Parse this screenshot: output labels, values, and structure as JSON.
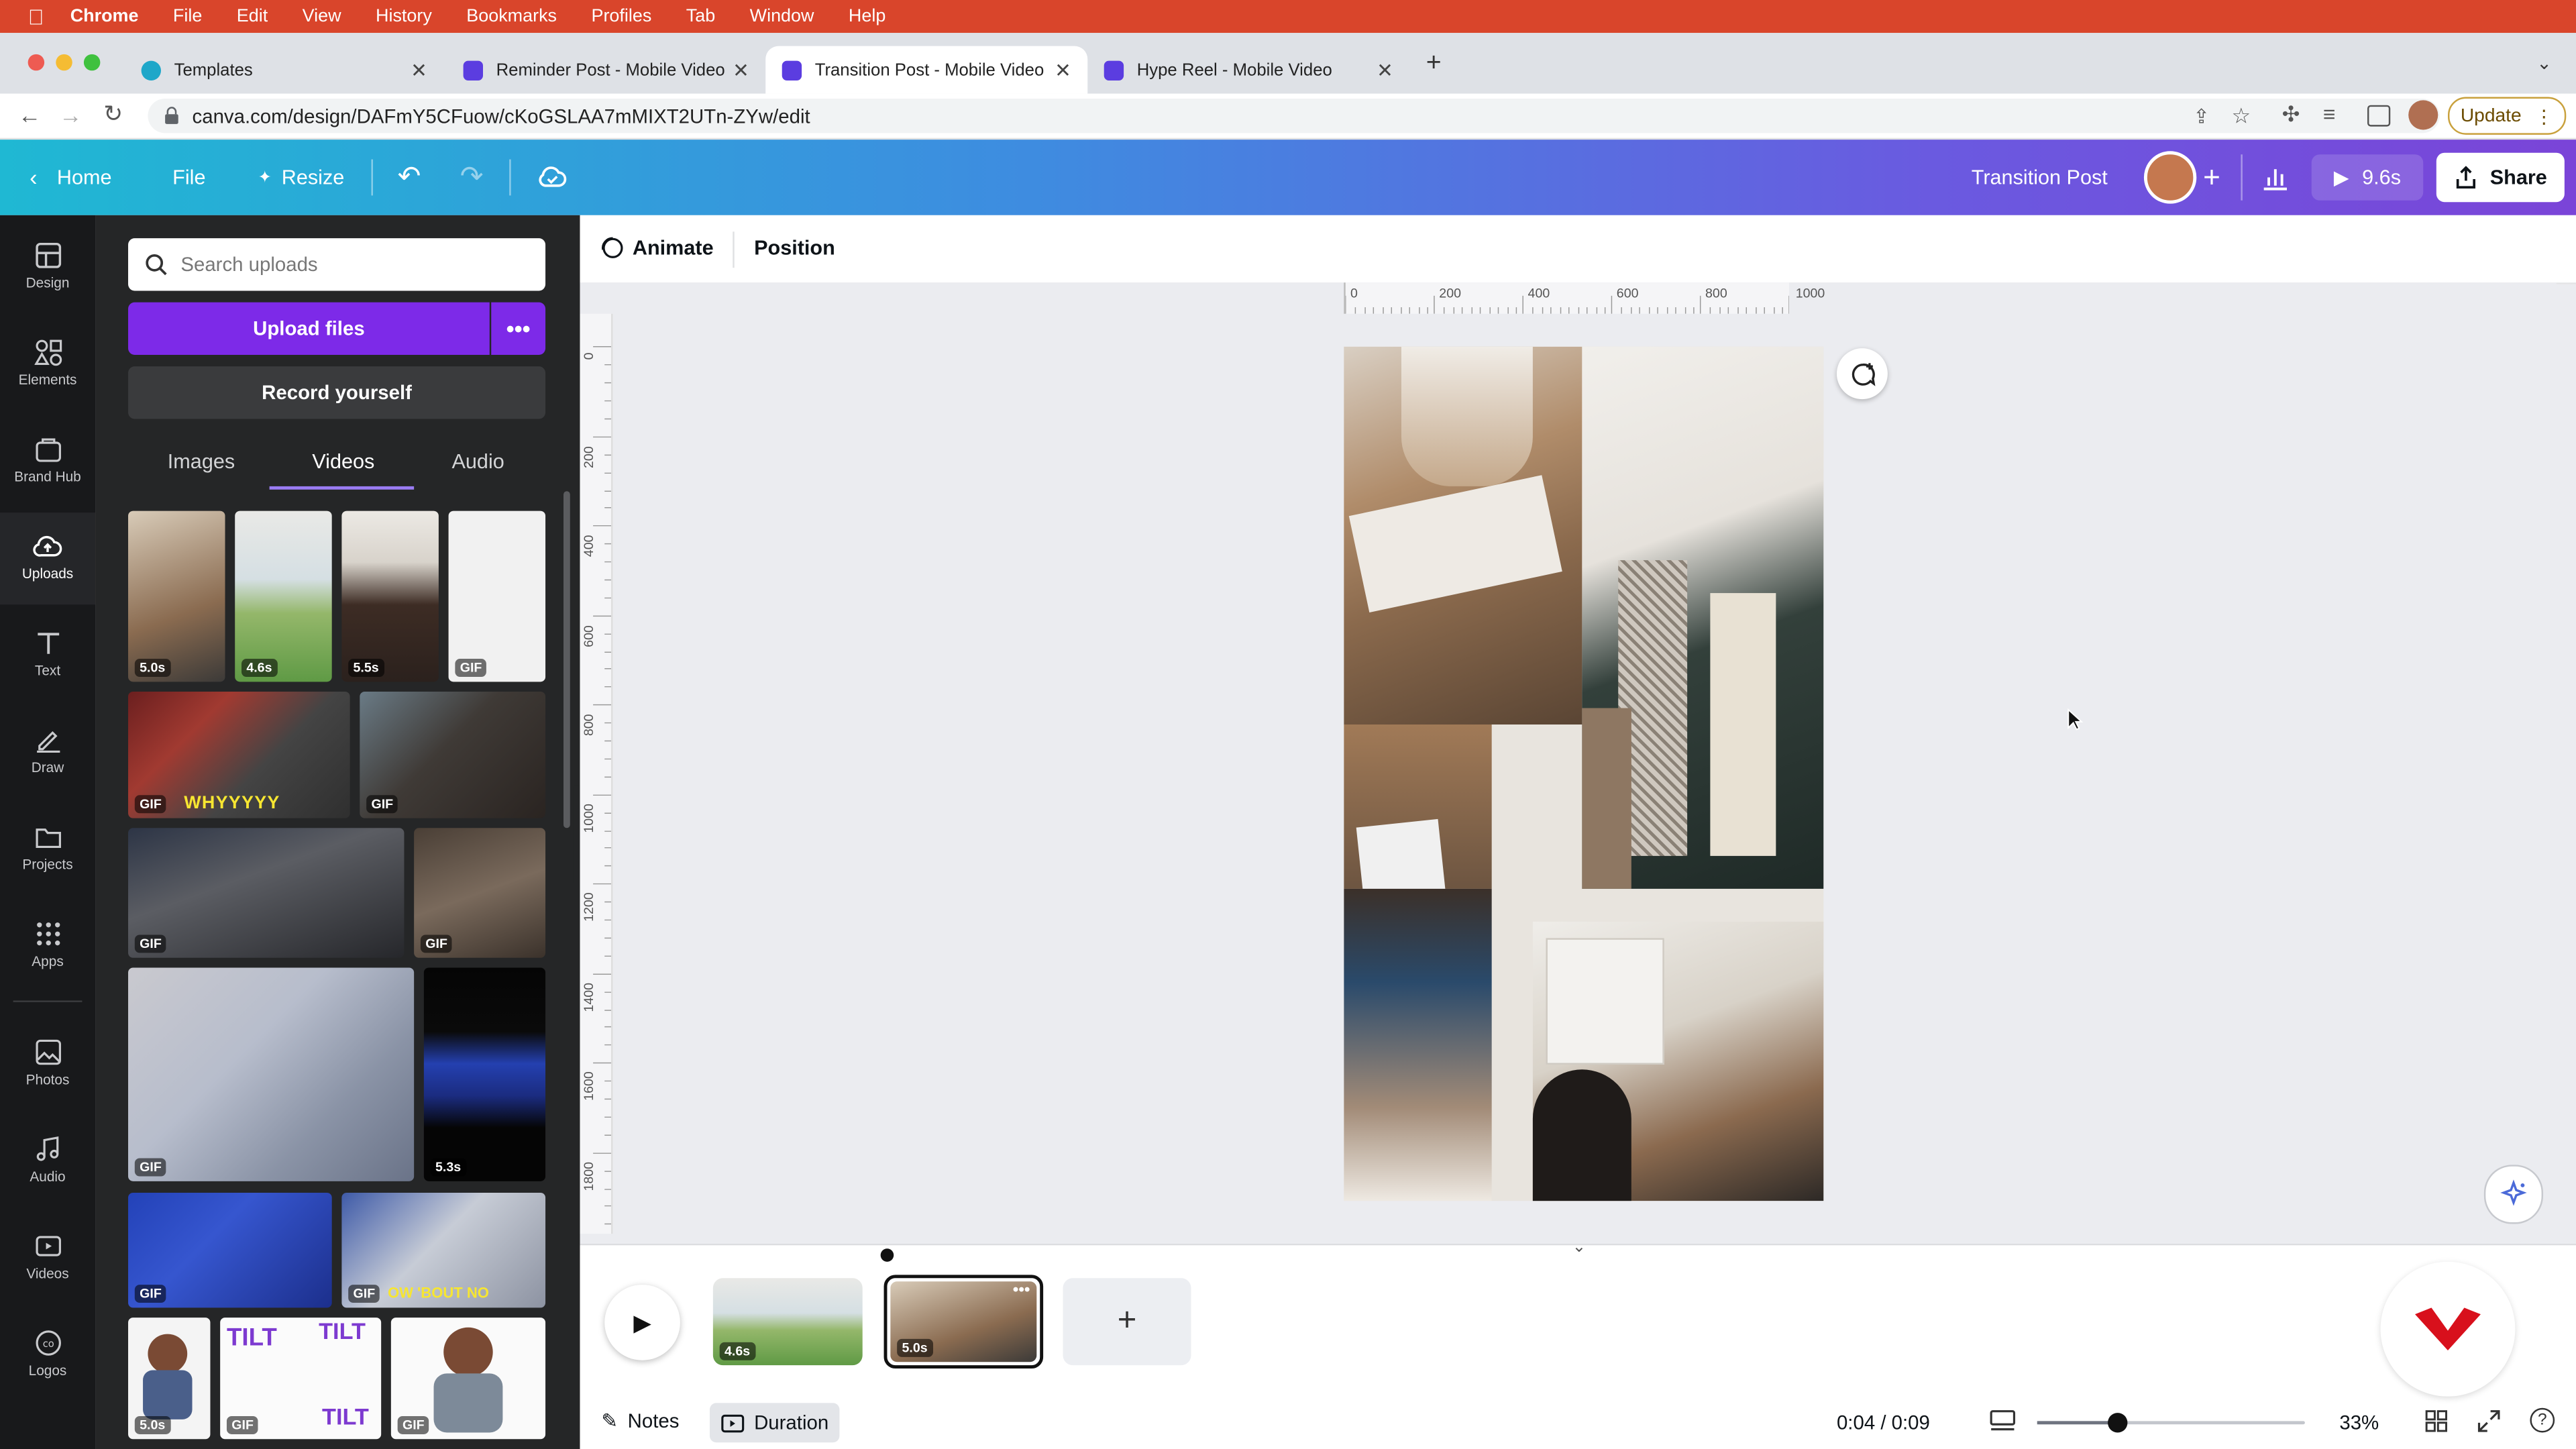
{
  "mac_menu": {
    "app": "Chrome",
    "items": [
      "File",
      "Edit",
      "View",
      "History",
      "Bookmarks",
      "Profiles",
      "Tab",
      "Window",
      "Help"
    ]
  },
  "browser": {
    "tabs": [
      {
        "title": "Templates",
        "favicon": "canva-c-icon"
      },
      {
        "title": "Reminder Post - Mobile Video",
        "favicon": "canva-video-icon"
      },
      {
        "title": "Transition Post - Mobile Video",
        "favicon": "canva-video-icon",
        "active": true
      },
      {
        "title": "Hype Reel - Mobile Video",
        "favicon": "canva-video-icon"
      }
    ],
    "url": "canva.com/design/DAFmY5CFuow/cKoGSLAA7mMIXT2UTn-ZYw/edit",
    "update_label": "Update"
  },
  "header": {
    "home": "Home",
    "file": "File",
    "resize": "Resize",
    "design_title": "Transition Post",
    "play_duration": "9.6s",
    "share": "Share"
  },
  "rail": [
    "Design",
    "Elements",
    "Brand Hub",
    "Uploads",
    "Text",
    "Draw",
    "Projects",
    "Apps",
    "Photos",
    "Audio",
    "Videos",
    "Logos"
  ],
  "panel": {
    "search_placeholder": "Search uploads",
    "upload_button": "Upload files",
    "record_button": "Record yourself",
    "tabs": [
      "Images",
      "Videos",
      "Audio"
    ],
    "active_tab": "Videos",
    "thumbs": [
      {
        "badge": "5.0s"
      },
      {
        "badge": "4.6s"
      },
      {
        "badge": "5.5s"
      },
      {
        "badge": "GIF"
      },
      {
        "badge": "GIF",
        "caption": "WHYYYYY"
      },
      {
        "badge": "GIF"
      },
      {
        "badge": "GIF"
      },
      {
        "badge": "GIF"
      },
      {
        "badge": "GIF"
      },
      {
        "badge": "5.3s"
      },
      {
        "badge": "GIF"
      },
      {
        "badge": "GIF",
        "caption": "OW 'BOUT NO"
      },
      {
        "badge": "5.0s"
      },
      {
        "badge": "GIF",
        "caption": "TILT"
      },
      {
        "badge": "GIF"
      }
    ]
  },
  "toolbar": {
    "animate": "Animate",
    "position": "Position"
  },
  "rulers": {
    "horizontal": [
      "0",
      "200",
      "400",
      "600",
      "800",
      "1000"
    ],
    "vertical": [
      "0",
      "200",
      "400",
      "600",
      "800",
      "1000",
      "1200",
      "1400",
      "1600",
      "1800"
    ]
  },
  "timeline": {
    "scenes": [
      {
        "duration": "4.6s"
      },
      {
        "duration": "5.0s"
      }
    ],
    "notes": "Notes",
    "duration": "Duration",
    "time": "0:04 / 0:09",
    "zoom_percent": "33%",
    "zoom_fraction": 0.3
  },
  "colors": {
    "accent": "#7d2ae8",
    "menubar": "#d9452b",
    "rail": "#18191b",
    "panel": "#252627"
  }
}
